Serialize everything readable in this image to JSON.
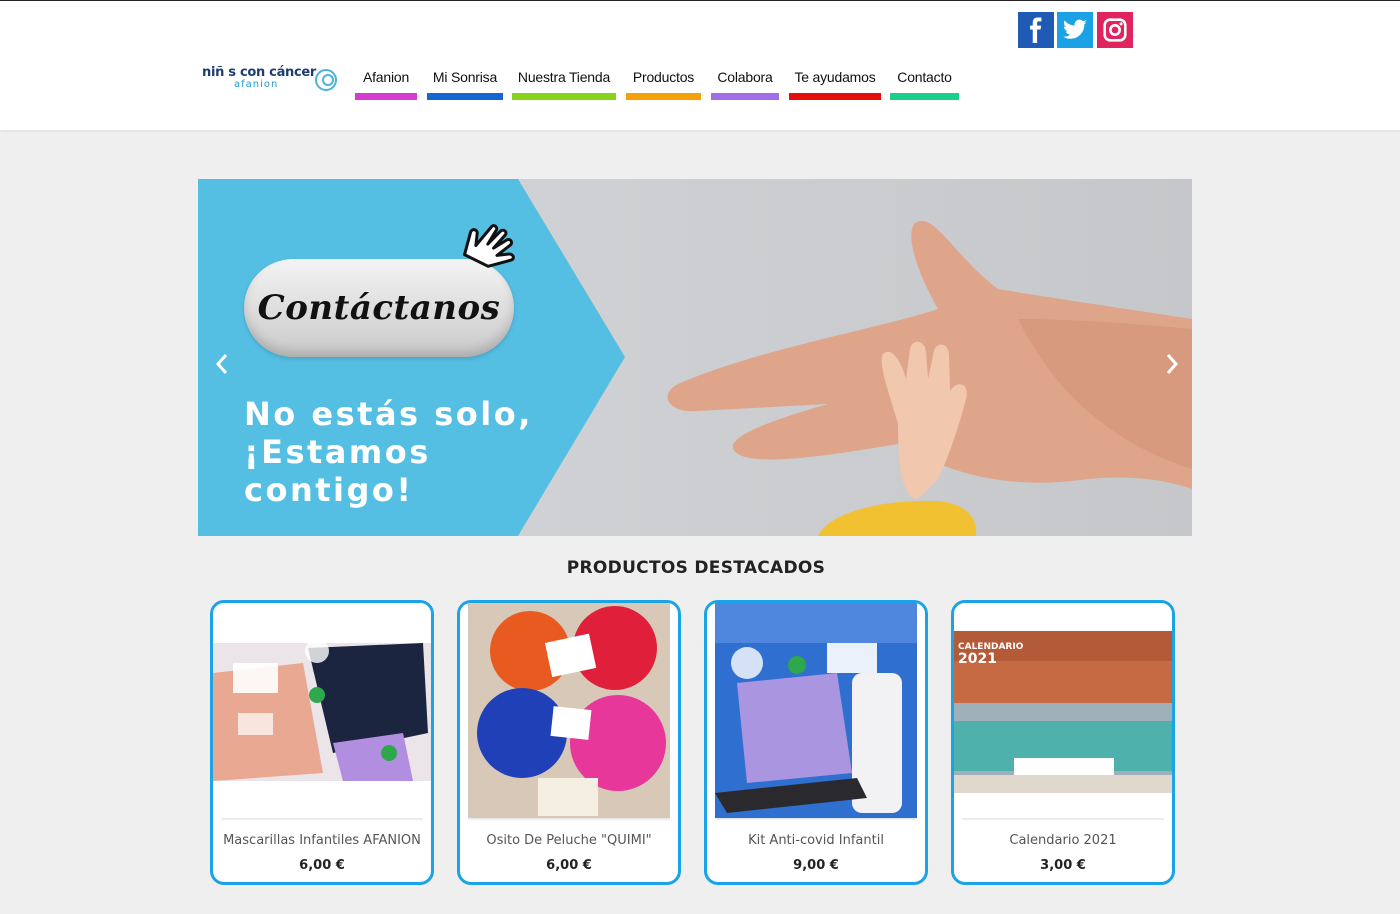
{
  "header": {
    "logo": {
      "line1": "niñ s con cáncer",
      "line2": "afanion"
    },
    "nav": [
      {
        "label": "Afanion",
        "color": "#d63bd0"
      },
      {
        "label": "Mi Sonrisa",
        "color": "#1466d2"
      },
      {
        "label": "Nuestra Tienda",
        "color": "#88d41a"
      },
      {
        "label": "Productos",
        "color": "#f5a20a"
      },
      {
        "label": "Colabora",
        "color": "#a06ee6"
      },
      {
        "label": "Te ayudamos",
        "color": "#e80c0c"
      },
      {
        "label": "Contacto",
        "color": "#18d08a"
      }
    ],
    "social": [
      {
        "icon": "facebook-icon",
        "color": "#1f5bb4"
      },
      {
        "icon": "twitter-icon",
        "color": "#1aa1e6"
      },
      {
        "icon": "instagram-icon",
        "color": "#e0245e"
      }
    ]
  },
  "banner": {
    "button_text": "Contáctanos",
    "message": "No estás solo,\n¡Estamos\ncontigo!",
    "accent_color": "#55bfe3",
    "prev_icon": "chevron-left-icon",
    "next_icon": "chevron-right-icon"
  },
  "products": {
    "title": "PRODUCTOS DESTACADOS",
    "items": [
      {
        "name": "Mascarillas Infantiles AFANION",
        "price": "6,00 €"
      },
      {
        "name": "Osito De Peluche \"QUIMI\"",
        "price": "6,00 €"
      },
      {
        "name": "Kit Anti-covid Infantil",
        "price": "9,00 €"
      },
      {
        "name": "Calendario 2021",
        "price": "3,00 €"
      }
    ]
  }
}
